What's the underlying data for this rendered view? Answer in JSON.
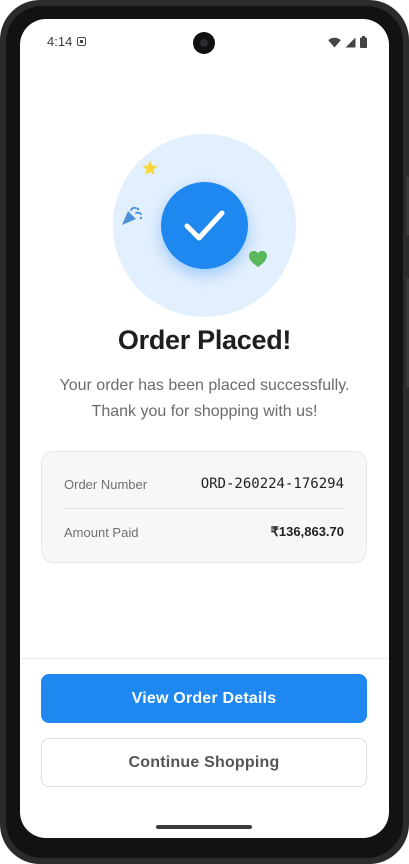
{
  "status_bar": {
    "time": "4:14",
    "icons": [
      "notification-icon",
      "wifi-icon",
      "signal-icon",
      "battery-icon"
    ]
  },
  "hero": {
    "icon": "checkmark-icon",
    "decorations": [
      "star-icon",
      "party-popper-icon",
      "heart-icon"
    ],
    "colors": {
      "circle": "#1e88f0",
      "halo": "#e2effd",
      "star": "#f9d537",
      "heart": "#5cb85c",
      "party": "#4a90d9"
    }
  },
  "title": "Order Placed!",
  "subtitle_line1": "Your order has been placed successfully.",
  "subtitle_line2": "Thank you for shopping with us!",
  "order_card": {
    "order_number_label": "Order Number",
    "order_number_value": "ORD-260224-176294",
    "amount_label": "Amount Paid",
    "amount_value": "₹136,863.70"
  },
  "actions": {
    "primary_label": "View Order Details",
    "secondary_label": "Continue Shopping"
  },
  "colors": {
    "accent": "#1e88f0"
  }
}
